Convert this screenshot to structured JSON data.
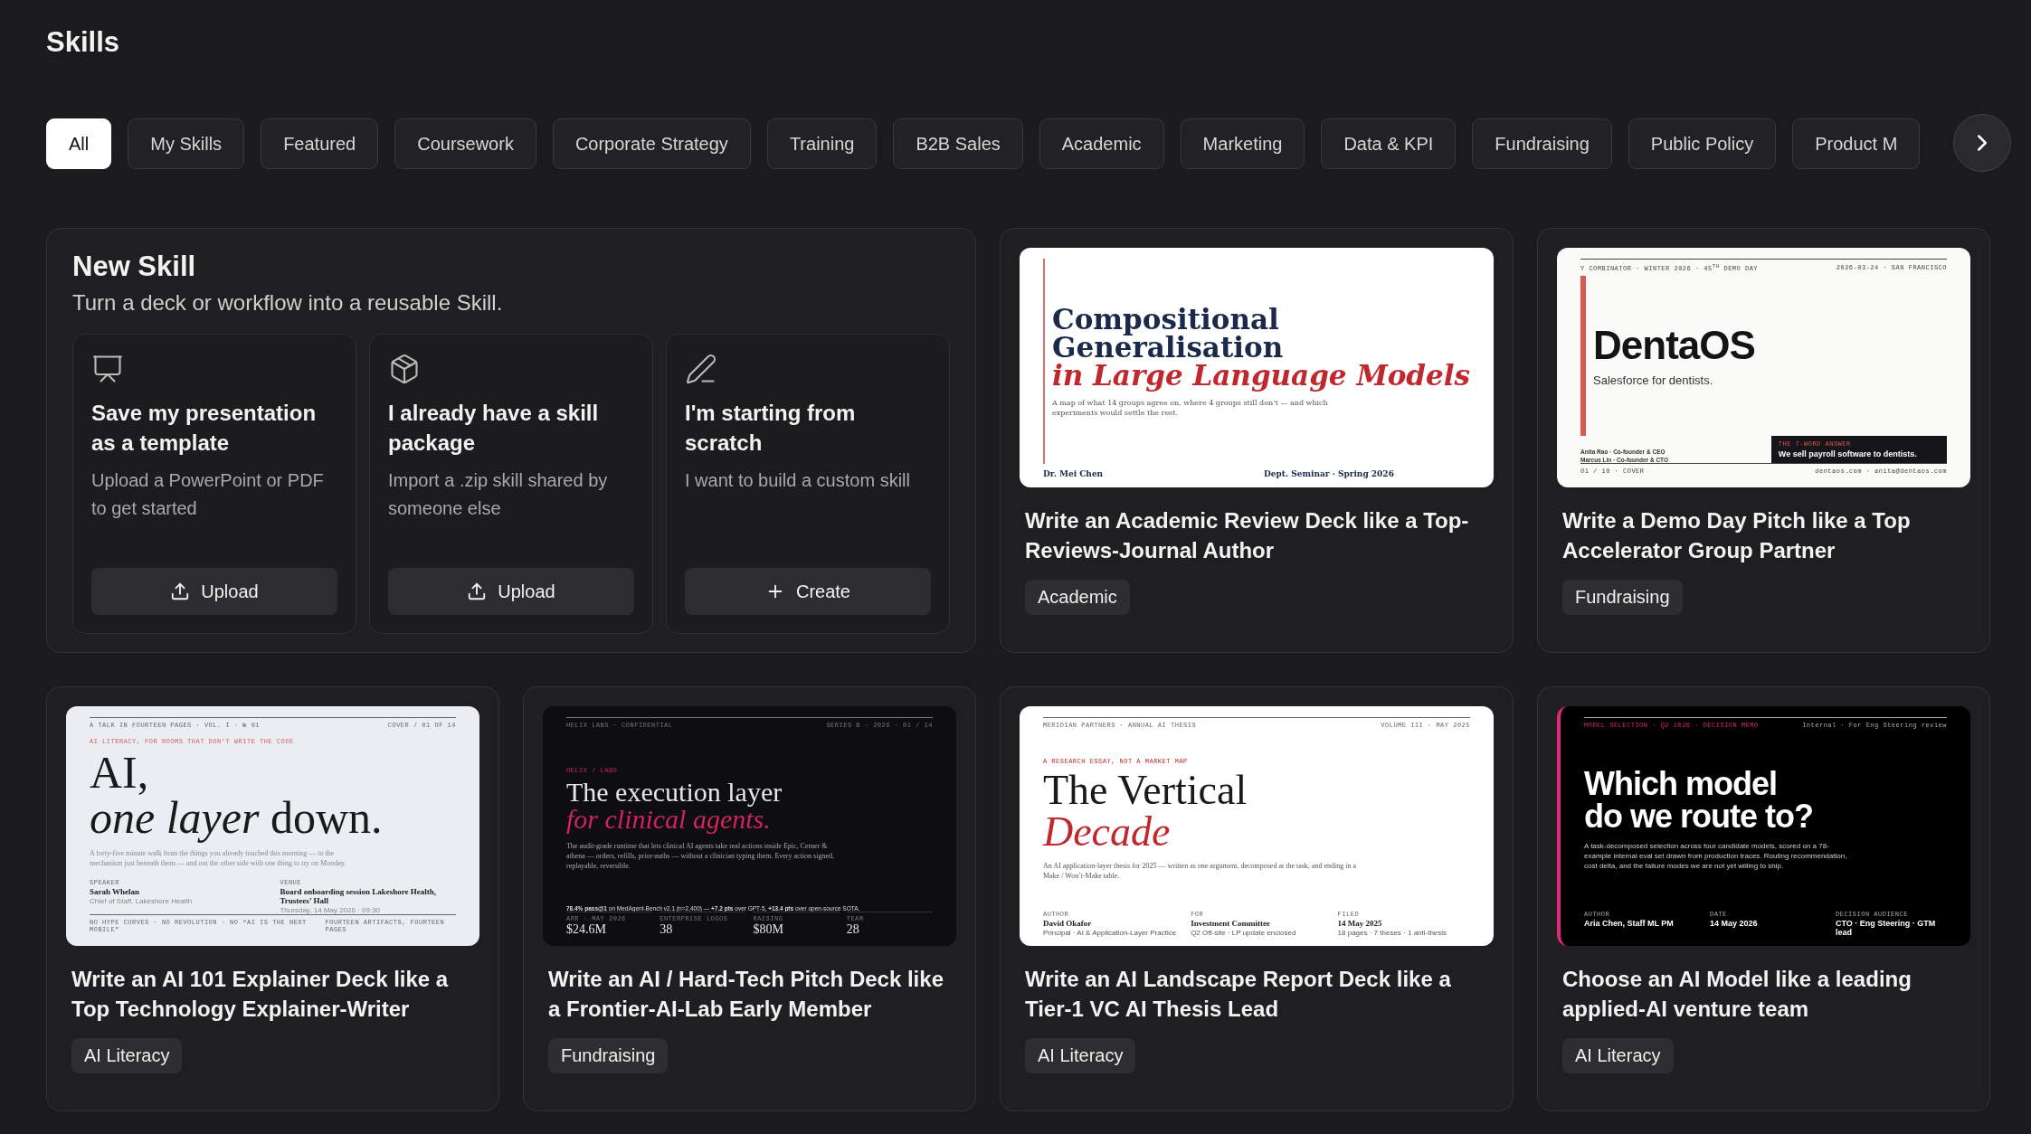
{
  "page_title": "Skills",
  "filters": [
    {
      "label": "All",
      "selected": true
    },
    {
      "label": "My Skills",
      "selected": false
    },
    {
      "label": "Featured",
      "selected": false
    },
    {
      "label": "Coursework",
      "selected": false
    },
    {
      "label": "Corporate Strategy",
      "selected": false
    },
    {
      "label": "Training",
      "selected": false
    },
    {
      "label": "B2B Sales",
      "selected": false
    },
    {
      "label": "Academic",
      "selected": false
    },
    {
      "label": "Marketing",
      "selected": false
    },
    {
      "label": "Data & KPI",
      "selected": false
    },
    {
      "label": "Fundraising",
      "selected": false
    },
    {
      "label": "Public Policy",
      "selected": false
    },
    {
      "label": "Product M",
      "selected": false
    }
  ],
  "new_skill": {
    "title": "New Skill",
    "subtitle": "Turn a deck or workflow into a reusable Skill.",
    "options": [
      {
        "kind": "presentation",
        "title": "Save my presentation as a template",
        "description": "Upload a PowerPoint or PDF to get started",
        "action": {
          "kind": "upload",
          "label": "Upload"
        }
      },
      {
        "kind": "package",
        "title": "I already have a skill package",
        "description": "Import a .zip skill shared by someone else",
        "action": {
          "kind": "upload",
          "label": "Upload"
        }
      },
      {
        "kind": "pen",
        "title": "I'm starting from scratch",
        "description": "I want to build a custom skill",
        "action": {
          "kind": "create",
          "label": "Create"
        }
      }
    ]
  },
  "skills": [
    {
      "title": "Write an Academic Review Deck like a Top-Reviews-Journal Author",
      "tag": "Academic",
      "preview": {
        "kind": "paper",
        "title": [
          {
            "text": "Compositional",
            "accent": false
          },
          {
            "text": "Generalisation",
            "accent": false
          },
          {
            "text": "in Large Language Models",
            "accent": true
          }
        ],
        "subtitle": "A map of what 14 groups agree on, where 4 groups still don’t — and which experiments would settle the rest.",
        "meta": [
          {
            "name": "Dr. Mei Chen"
          },
          {
            "name": "Dept. Seminar · Spring 2026"
          }
        ]
      }
    },
    {
      "title": "Write a Demo Day Pitch like a Top Accelerator Group Partner",
      "tag": "Fundraising",
      "preview": {
        "kind": "startup",
        "header_left": "Y COMBINATOR · WINTER 2026 · 45$^{TH}$ DEMO DAY",
        "header_right": "2026-03-24 · SAN FRANCISCO",
        "title": [
          {
            "text": "DentaOS",
            "accent": false
          }
        ],
        "subtitle": "Salesforce for dentists.",
        "team": [
          "Anita Rao · Co-founder & CEO",
          "Marcus Lin · Co-founder & CTO"
        ],
        "callout": {
          "label": "THE 7-WORD ANSWER",
          "text": "We sell payroll software to dentists."
        },
        "footer_left": "01 / 10 · COVER",
        "footer_right": "dentaos.com · anita@dentaos.com"
      }
    },
    {
      "title": "Write an AI 101 Explainer Deck like a Top Technology Explainer-Writer",
      "tag": "AI Literacy",
      "preview": {
        "kind": "explainer",
        "header_left": "A TALK IN FOURTEEN PAGES · VOL. I · № 01",
        "header_right": "COVER / 01 OF 14",
        "eyebrow": "AI LITERACY, FOR ROOMS THAT DON’T WRITE THE CODE",
        "title": [
          {
            "text": "AI,",
            "accent": false
          },
          {
            "text": "*one layer* down.",
            "accent": false
          }
        ],
        "subtitle": "A forty-five minute walk from the things you already touched this morning — to the mechanism just beneath them — and out the other side with one thing to try on Monday.",
        "meta": [
          {
            "label": "SPEAKER",
            "name": "Sarah Whelan",
            "detail": "Chief of Staff, Lakeshore Health"
          },
          {
            "label": "VENUE",
            "name": "Board onboarding session Lakeshore Health, Trustees’ Hall",
            "detail": "Thursday, 14 May 2026 · 09:30"
          }
        ],
        "footer_left": "NO HYPE CURVES · NO REVOLUTION · NO “AI IS THE NEXT MOBILE”",
        "footer_right": "FOURTEEN ARTIFACTS, FOURTEEN PAGES"
      }
    },
    {
      "title": "Write an AI / Hard-Tech Pitch Deck like a Frontier-AI-Lab Early Member",
      "tag": "Fundraising",
      "preview": {
        "kind": "darkpitch",
        "header_left": "HELIX LABS · CONFIDENTIAL",
        "header_right": "SERIES B · 2026 · 01 / 14",
        "eyebrow": "HELIX / LABS",
        "title": [
          {
            "text": "The execution layer",
            "accent": false
          },
          {
            "text": "for clinical agents.",
            "accent": true
          }
        ],
        "subtitle": "The audit-grade runtime that lets clinical AI agents take real actions inside Epic, Cerner & athena — orders, refills, prior-auths — without a clinician typing them. Every action signed, replayable, reversible.",
        "headline": "**78.4% pass@1** on MedAgent-Bench v2.1 (n=2,400) — **+7.2 pts** over GPT-5, **+13.4 pts** over open-source SOTA.",
        "stats": [
          {
            "label": "ARR · MAY 2026",
            "value": "$24.6M"
          },
          {
            "label": "ENTERPRISE LOGOS",
            "value": "38"
          },
          {
            "label": "RAISING",
            "value": "$80M"
          },
          {
            "label": "TEAM",
            "value": "28"
          }
        ]
      }
    },
    {
      "title": "Write an AI Landscape Report Deck like a Tier-1 VC AI Thesis Lead",
      "tag": "AI Literacy",
      "preview": {
        "kind": "editorial",
        "header_left": "MERIDIAN PARTNERS · ANNUAL AI THESIS",
        "header_right": "VOLUME III · MAY 2025",
        "eyebrow": "A RESEARCH ESSAY, NOT A MARKET MAP",
        "title": [
          {
            "text": "The Vertical",
            "accent": false
          },
          {
            "text": "Decade",
            "accent": true
          }
        ],
        "subtitle": "An AI application-layer thesis for 2025 — written as one argument, decomposed at the task, and ending in a Make / Won’t-Make table.",
        "meta": [
          {
            "label": "AUTHOR",
            "name": "David Okafor",
            "detail": "Principal · AI & Application-Layer Practice"
          },
          {
            "label": "FOR",
            "name": "Investment Committee",
            "detail": "Q2 Off-site · LP update enclosed"
          },
          {
            "label": "FILED",
            "name": "14 May 2025",
            "detail": "18 pages · 7 theses · 1 anti-thesis"
          }
        ]
      }
    },
    {
      "title": "Choose an AI Model like a leading applied-AI venture team",
      "tag": "AI Literacy",
      "preview": {
        "kind": "memo",
        "header_left": "MODEL SELECTION · Q2 2026 · DECISION MEMO",
        "header_right": "Internal · For Eng Steering review",
        "title": [
          {
            "text": "Which model",
            "accent": false
          },
          {
            "text": "do we route to?",
            "accent": false
          }
        ],
        "subtitle": "A task-decomposed selection across four candidate models, scored on a 78-example internal eval set drawn from production traces. Routing recommendation, cost delta, and the failure modes we are not yet willing to ship.",
        "meta": [
          {
            "label": "AUTHOR",
            "name": "Aria Chen, Staff ML PM"
          },
          {
            "label": "DATE",
            "name": "14 May 2026"
          },
          {
            "label": "DECISION AUDIENCE",
            "name": "CTO · Eng Steering · GTM lead"
          }
        ]
      }
    }
  ]
}
